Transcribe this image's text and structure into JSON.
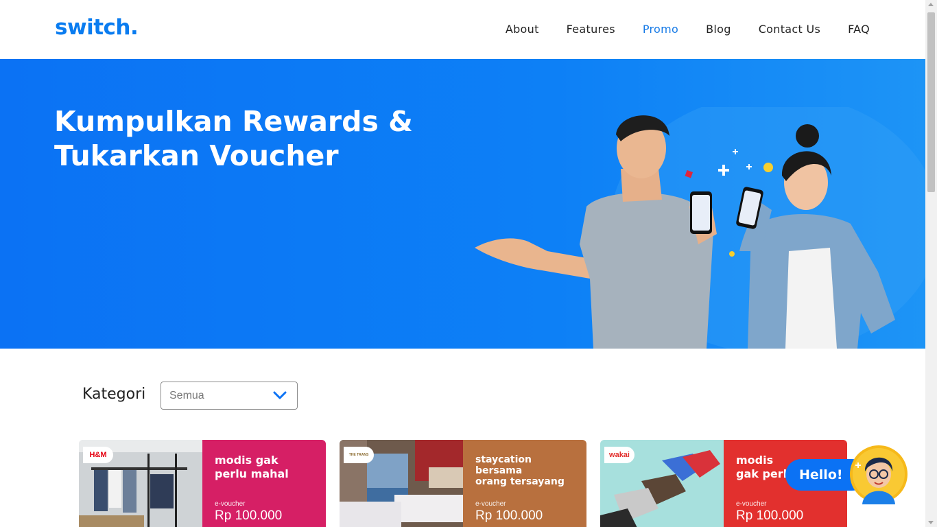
{
  "brand": {
    "logo": "switch."
  },
  "nav": [
    {
      "label": "About"
    },
    {
      "label": "Features"
    },
    {
      "label": "Promo"
    },
    {
      "label": "Blog"
    },
    {
      "label": "Contact Us"
    },
    {
      "label": "FAQ"
    }
  ],
  "hero": {
    "title_line1": "Kumpulkan Rewards &",
    "title_line2": "Tukarkan Voucher"
  },
  "filter": {
    "label": "Kategori",
    "selected": "Semua"
  },
  "cards": [
    {
      "brand": "H&M",
      "tagline_1": "modis gak",
      "tagline_2": "perlu mahal",
      "tagline_3": "",
      "evoucher": "e-voucher",
      "price": "Rp 100.000",
      "panel_color": "#d61f65"
    },
    {
      "brand": "THE TRANS",
      "tagline_1": "staycation",
      "tagline_2": "bersama",
      "tagline_3": "orang tersayang",
      "evoucher": "e-voucher",
      "price": "Rp 100.000",
      "panel_color": "#b8703e"
    },
    {
      "brand": "wakai",
      "tagline_1": "modis",
      "tagline_2": "gak perlu mahal",
      "tagline_3": "",
      "evoucher": "e-voucher",
      "price": "Rp 100.000",
      "panel_color": "#e2302e"
    }
  ],
  "chat": {
    "greeting": "Hello!"
  },
  "colors": {
    "primary": "#0b72f4",
    "nav_active": "#1479e6"
  }
}
